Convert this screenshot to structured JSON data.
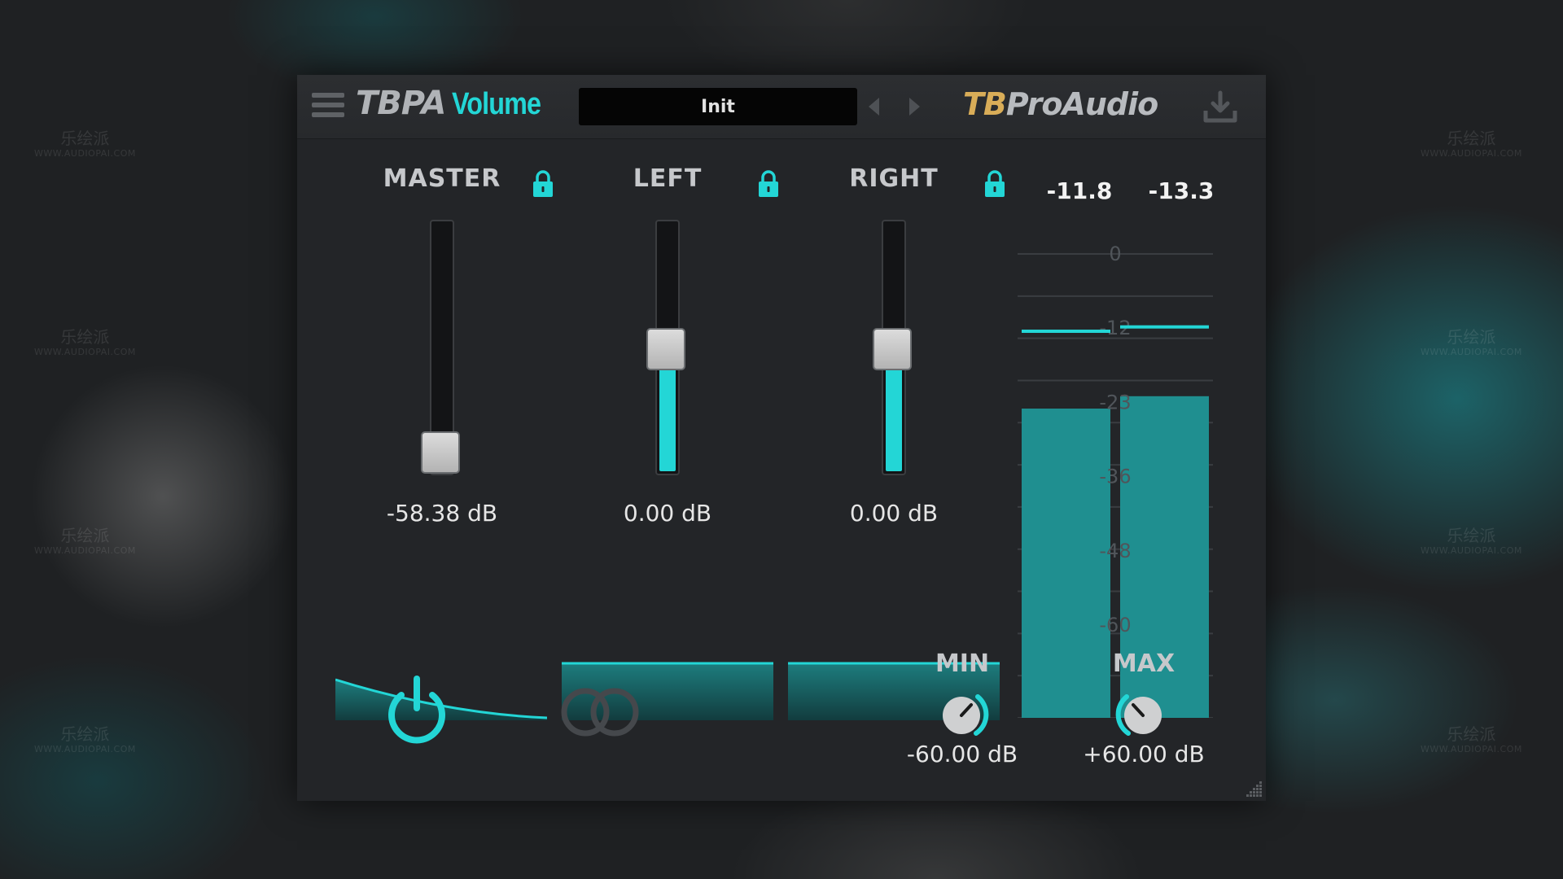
{
  "watermark": {
    "cn": "乐绘派",
    "url": "WWW.AUDIOPAI.COM"
  },
  "app": {
    "title_prefix": "TBPA",
    "title_name": "Volume",
    "preset": "Init",
    "brand_tb": "TB",
    "brand_rest": "ProAudio"
  },
  "channels": [
    {
      "label": "MASTER",
      "value_text": "-58.38 dB",
      "position": 0.0,
      "locked": true
    },
    {
      "label": "LEFT",
      "value_text": "0.00 dB",
      "position": 0.5,
      "locked": true
    },
    {
      "label": "RIGHT",
      "value_text": "0.00 dB",
      "position": 0.5,
      "locked": true
    }
  ],
  "meters": {
    "left_readout": "-11.8",
    "right_readout": "-13.3",
    "scale_labels": [
      "0",
      "-12",
      "-23",
      "-36",
      "-48",
      "-60"
    ],
    "left_level_db": -25,
    "right_level_db": -23,
    "left_peak_db": -12.5,
    "right_peak_db": -11.8
  },
  "controls": {
    "min_label": "MIN",
    "min_value": "-60.00 dB",
    "max_label": "MAX",
    "max_value": "+60.00 dB"
  },
  "colors": {
    "accent": "#23d6d6",
    "meter_fill": "#1f8f90",
    "brand_gold": "#d9ad58",
    "panel": "#232528"
  },
  "icons": {
    "menu": "hamburger-menu-icon",
    "prev": "arrow-left-icon",
    "next": "arrow-right-icon",
    "save": "download-icon",
    "lock": "lock-icon",
    "power": "power-icon",
    "link": "link-rings-icon",
    "resize": "resize-grip-icon"
  }
}
